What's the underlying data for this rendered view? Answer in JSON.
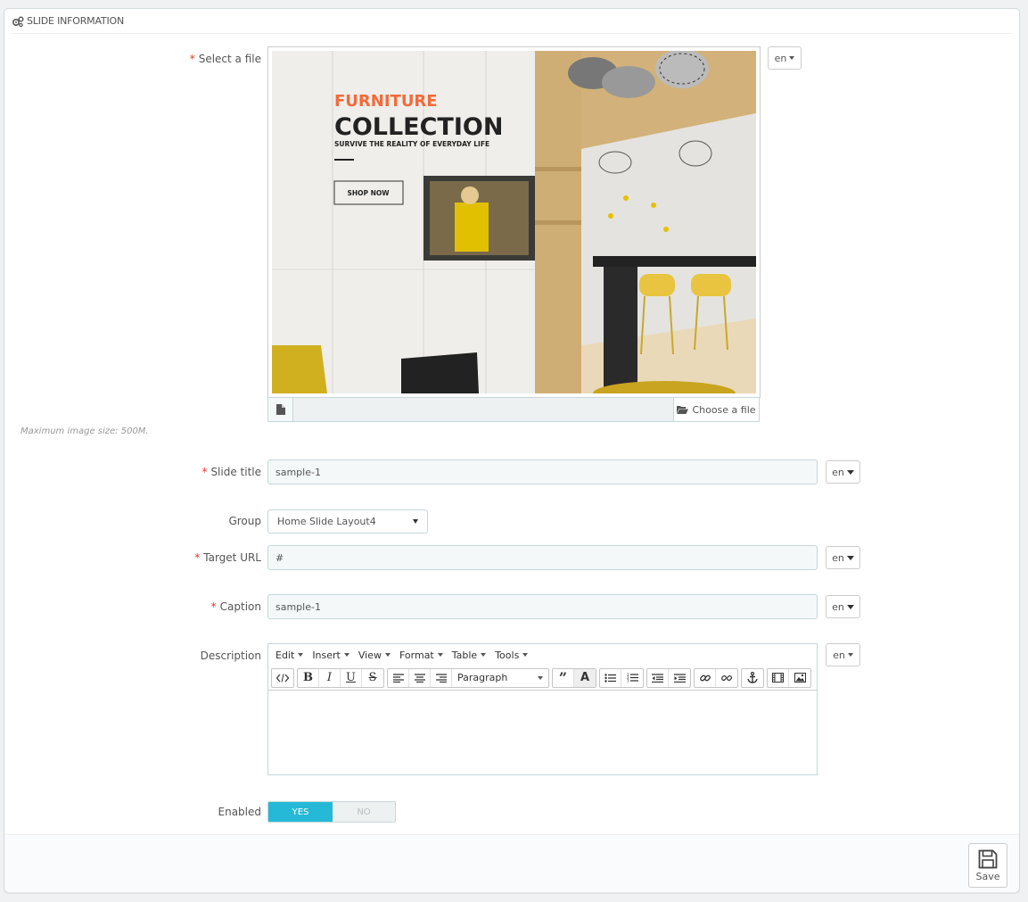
{
  "panel": {
    "heading": "SLIDE INFORMATION"
  },
  "fields": {
    "file": {
      "label": "Select a file",
      "lang": "en",
      "choose_label": "Choose a file",
      "help": "Maximum image size: 500M."
    },
    "banner": {
      "title_accent": "FURNITURE",
      "title_main": "COLLECTION",
      "subtitle": "SURVIVE THE REALITY OF EVERYDAY LIFE",
      "cta": "SHOP NOW"
    },
    "slide_title": {
      "label": "Slide title",
      "value": "sample-1",
      "lang": "en"
    },
    "group": {
      "label": "Group",
      "selected": "Home Slide Layout4"
    },
    "target_url": {
      "label": "Target URL",
      "value": "#",
      "lang": "en"
    },
    "caption": {
      "label": "Caption",
      "value": "sample-1",
      "lang": "en"
    },
    "description": {
      "label": "Description",
      "lang": "en",
      "menu": [
        "Edit",
        "Insert",
        "View",
        "Format",
        "Table",
        "Tools"
      ],
      "format_select": "Paragraph"
    },
    "enabled": {
      "label": "Enabled",
      "yes": "YES",
      "no": "NO",
      "value": "YES"
    }
  },
  "footer": {
    "save_label": "Save"
  },
  "colors": {
    "accent": "#25b9d7",
    "required": "#e5322d",
    "banner_accent": "#f26b3a"
  }
}
